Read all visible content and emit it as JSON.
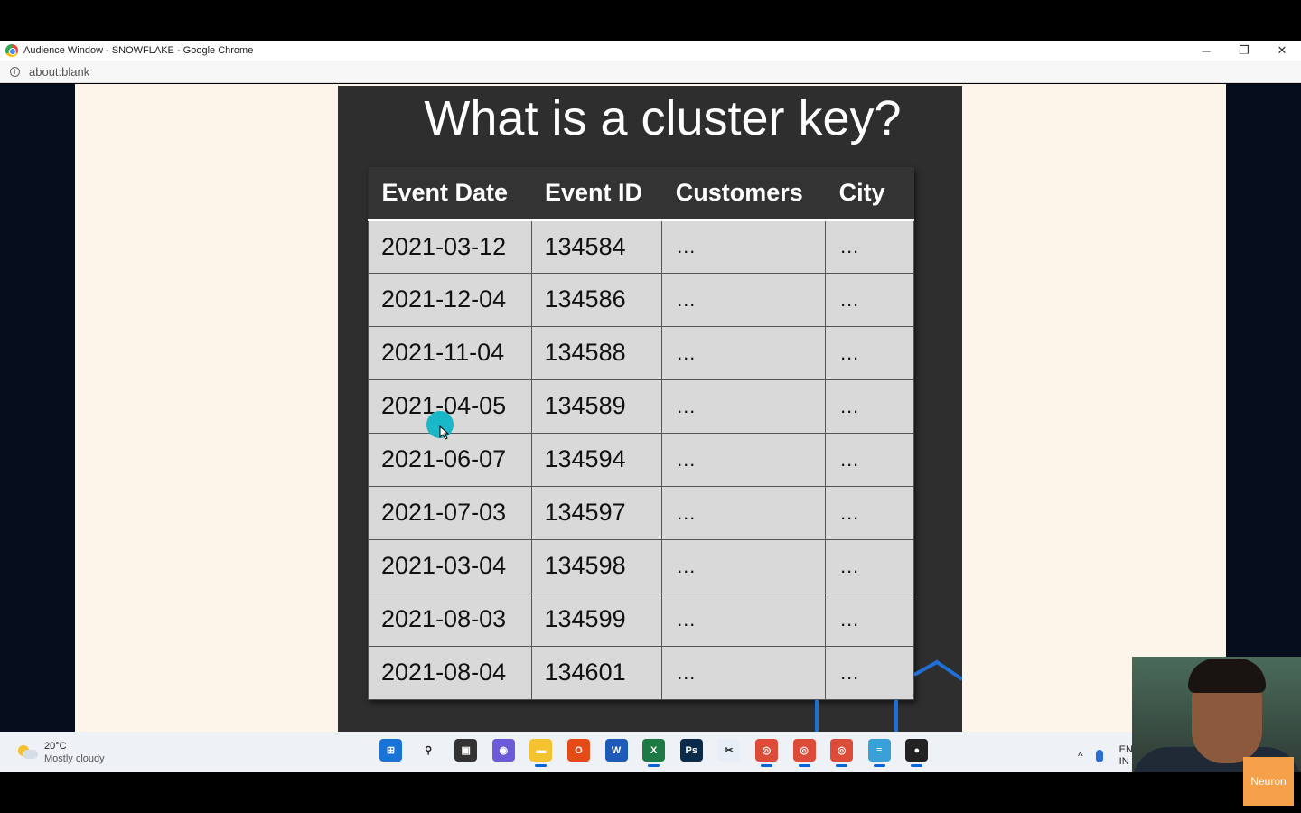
{
  "window": {
    "title": "Audience Window - SNOWFLAKE - Google Chrome",
    "url": "about:blank",
    "minimize": "─",
    "maximize": "❐",
    "close": "✕"
  },
  "slide": {
    "title": "What is a cluster key?",
    "columns": [
      "Event Date",
      "Event ID",
      "Customers",
      "City"
    ],
    "rows": [
      [
        "2021-03-12",
        "134584",
        "…",
        "…"
      ],
      [
        "2021-12-04",
        "134586",
        "…",
        "…"
      ],
      [
        "2021-11-04",
        "134588",
        "…",
        "…"
      ],
      [
        "2021-04-05",
        "134589",
        "…",
        "…"
      ],
      [
        "2021-06-07",
        "134594",
        "…",
        "…"
      ],
      [
        "2021-07-03",
        "134597",
        "…",
        "…"
      ],
      [
        "2021-03-04",
        "134598",
        "…",
        "…"
      ],
      [
        "2021-08-03",
        "134599",
        "…",
        "…"
      ],
      [
        "2021-08-04",
        "134601",
        "…",
        "…"
      ]
    ]
  },
  "taskbar": {
    "weather_temp": "20°C",
    "weather_desc": "Mostly cloudy",
    "apps": [
      {
        "name": "start-icon",
        "color": "#1a74d8",
        "glyph": "⊞",
        "active": false
      },
      {
        "name": "search-icon",
        "color": "#eef1f5",
        "glyph": "⚲",
        "active": false
      },
      {
        "name": "task-view-icon",
        "color": "#333333",
        "glyph": "▣",
        "active": false
      },
      {
        "name": "chat-icon",
        "color": "#6b5bd6",
        "glyph": "◉",
        "active": false
      },
      {
        "name": "file-explorer-icon",
        "color": "#f4c430",
        "glyph": "▬",
        "active": true
      },
      {
        "name": "office-icon",
        "color": "#e64a19",
        "glyph": "O",
        "active": false
      },
      {
        "name": "word-icon",
        "color": "#1e5bb8",
        "glyph": "W",
        "active": false
      },
      {
        "name": "excel-icon",
        "color": "#1d7a45",
        "glyph": "X",
        "active": true
      },
      {
        "name": "photoshop-icon",
        "color": "#0b2b4a",
        "glyph": "Ps",
        "active": false
      },
      {
        "name": "snipping-tool-icon",
        "color": "#e8eef8",
        "glyph": "✂",
        "active": false
      },
      {
        "name": "chrome-icon",
        "color": "#dd4b39",
        "glyph": "◎",
        "active": true
      },
      {
        "name": "chrome-profile-2-icon",
        "color": "#dd4b39",
        "glyph": "◎",
        "active": true
      },
      {
        "name": "chrome-profile-3-icon",
        "color": "#dd4b39",
        "glyph": "◎",
        "active": true
      },
      {
        "name": "notepad-icon",
        "color": "#3aa0d8",
        "glyph": "≡",
        "active": true
      },
      {
        "name": "obs-icon",
        "color": "#222222",
        "glyph": "●",
        "active": true
      }
    ],
    "tray_chevron": "^",
    "lang": "ENG",
    "lang_sub": "IN"
  },
  "overlay": {
    "badge": "Neuron"
  }
}
